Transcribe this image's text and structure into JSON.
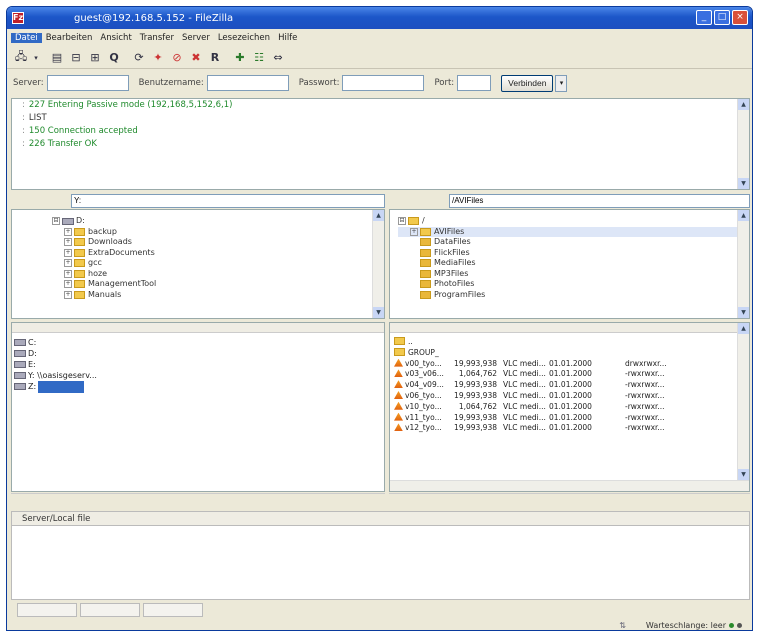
{
  "window": {
    "title": "guest@192.168.5.152 - FileZilla",
    "app_icon": "filezilla-icon"
  },
  "menu": [
    "Datei",
    "Bearbeiten",
    "Ansicht",
    "Transfer",
    "Server",
    "Lesezeichen",
    "Hilfe"
  ],
  "toolbar_icons": [
    "site-manager-icon",
    "dropdown-icon",
    "log-toggle-icon",
    "tree-local-icon",
    "tree-remote-icon",
    "queue-icon",
    "refresh-icon",
    "process-queue-icon",
    "cancel-icon",
    "disconnect-icon",
    "reconnect-icon",
    "filter-icon",
    "compare-icon",
    "sync-browse-icon"
  ],
  "quickconnect": {
    "server_label": "Server:",
    "server_value": "",
    "user_label": "Benutzername:",
    "user_value": "",
    "pass_label": "Passwort:",
    "pass_value": "",
    "port_label": "Port:",
    "port_value": "",
    "connect_label": "Verbinden"
  },
  "log": [
    {
      "text": "227 Entering Passive mode (192,168,5,152,6,1)",
      "type": "resp"
    },
    {
      "text": "LIST",
      "type": "cmd"
    },
    {
      "text": "150 Connection accepted",
      "type": "resp"
    },
    {
      "text": "226 Transfer OK",
      "type": "resp"
    }
  ],
  "local": {
    "path": "Y:",
    "tree": [
      {
        "name": "D:",
        "level": 0
      },
      {
        "name": "backup",
        "level": 1
      },
      {
        "name": "Downloads",
        "level": 1
      },
      {
        "name": "ExtraDocuments",
        "level": 1
      },
      {
        "name": "gcc",
        "level": 1
      },
      {
        "name": "hoze",
        "level": 1
      },
      {
        "name": "ManagementTool",
        "level": 1
      },
      {
        "name": "Manuals",
        "level": 1
      }
    ],
    "drives": [
      {
        "label": "C:"
      },
      {
        "label": "D:"
      },
      {
        "label": "E:"
      },
      {
        "label": "Y: \\\\oasisgeserv..."
      },
      {
        "label": "Z:"
      }
    ]
  },
  "remote": {
    "path": "/AVIFiles",
    "tree": [
      {
        "name": "/",
        "level": 0
      },
      {
        "name": "AVIFiles",
        "level": 1,
        "selected": true
      },
      {
        "name": "DataFiles",
        "level": 1
      },
      {
        "name": "FlickFiles",
        "level": 1
      },
      {
        "name": "MediaFiles",
        "level": 1
      },
      {
        "name": "MP3Files",
        "level": 1
      },
      {
        "name": "PhotoFiles",
        "level": 1
      },
      {
        "name": "ProgramFiles",
        "level": 1
      }
    ],
    "files": [
      {
        "name": "..",
        "size": "",
        "type": "",
        "date": "",
        "perm": ""
      },
      {
        "name": "GROUP_",
        "size": "",
        "type": "",
        "date": "",
        "perm": ""
      },
      {
        "name": "v00_tyo...",
        "size": "19,993,938",
        "type": "VLC medi...",
        "date": "01.01.2000",
        "perm": "drwxrwxr..."
      },
      {
        "name": "v03_v06...",
        "size": "1,064,762",
        "type": "VLC medi...",
        "date": "01.01.2000",
        "perm": "-rwxrwxr..."
      },
      {
        "name": "v04_v09...",
        "size": "19,993,938",
        "type": "VLC medi...",
        "date": "01.01.2000",
        "perm": "-rwxrwxr..."
      },
      {
        "name": "v06_tyo...",
        "size": "19,993,938",
        "type": "VLC medi...",
        "date": "01.01.2000",
        "perm": "-rwxrwxr..."
      },
      {
        "name": "v10_tyo...",
        "size": "1,064,762",
        "type": "VLC medi...",
        "date": "01.01.2000",
        "perm": "-rwxrwxr..."
      },
      {
        "name": "v11_tyo...",
        "size": "19,993,938",
        "type": "VLC medi...",
        "date": "01.01.2000",
        "perm": "-rwxrwxr..."
      },
      {
        "name": "v12_tyo...",
        "size": "19,993,938",
        "type": "VLC medi...",
        "date": "01.01.2000",
        "perm": "-rwxrwxr..."
      }
    ]
  },
  "queue": {
    "header": "Server/Local file"
  },
  "status": {
    "queue_label": "Warteschlange: leer"
  }
}
